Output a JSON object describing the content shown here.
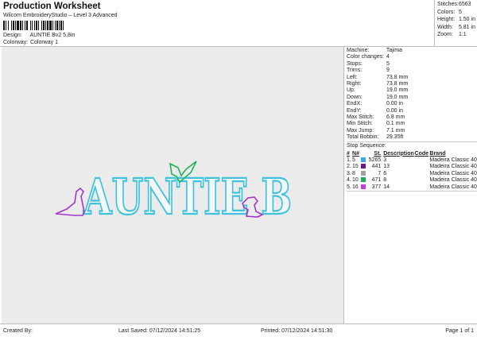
{
  "header": {
    "title": "Production Worksheet",
    "subtitle": "Wilcom EmbroideryStudio – Level 3 Advanced",
    "design_label": "Design:",
    "design_value": "AUNTIE Bv2 5,8in",
    "colorway_label": "Colorway:",
    "colorway_value": "Colorway 1"
  },
  "stats": [
    {
      "k": "Stitches:",
      "v": "6563"
    },
    {
      "k": "Colors:",
      "v": "5"
    },
    {
      "k": "Height:",
      "v": "1.50 in"
    },
    {
      "k": "Width:",
      "v": "5.81 in"
    },
    {
      "k": "Zoom:",
      "v": "1:1"
    }
  ],
  "design": {
    "text": "AUNTIE B",
    "colors": {
      "letters": "#3fc3dc",
      "butterfly": "#22b35a",
      "dino": "#a535c8",
      "background": "#ebebeb"
    }
  },
  "details": [
    {
      "k": "Machine:",
      "v": "Tajima"
    },
    {
      "k": "Color changes:",
      "v": "4"
    },
    {
      "k": "Stops:",
      "v": "5"
    },
    {
      "k": "Trims:",
      "v": "9"
    },
    {
      "k": "Left:",
      "v": "73.8 mm"
    },
    {
      "k": "Right:",
      "v": "73.8 mm"
    },
    {
      "k": "Up:",
      "v": "19.0 mm"
    },
    {
      "k": "Down:",
      "v": "19.0 mm"
    },
    {
      "k": "EndX:",
      "v": "0.00 in"
    },
    {
      "k": "EndY:",
      "v": "0.00 in"
    },
    {
      "k": "Max Stitch:",
      "v": "6.8 mm"
    },
    {
      "k": "Min Stitch:",
      "v": "0.1 mm"
    },
    {
      "k": "Max Jump:",
      "v": "7.1 mm"
    },
    {
      "k": "Total Bobbin:",
      "v": "29.35ft"
    }
  ],
  "stop_sequence": {
    "title": "Stop Sequence:",
    "headers": [
      "#",
      "N#",
      "",
      "St.",
      "Description",
      "Code",
      "Brand"
    ],
    "rows": [
      {
        "idx": "1.",
        "n": "5",
        "color": "#3aa8e8",
        "st": "5265",
        "desc": "3",
        "code": "",
        "brand": "Madeira Classic 40"
      },
      {
        "idx": "2.",
        "n": "15",
        "color": "#6a1a8c",
        "st": "441",
        "desc": "13",
        "code": "",
        "brand": "Madeira Classic 40"
      },
      {
        "idx": "3.",
        "n": "8",
        "color": "#a0a0a0",
        "st": "7",
        "desc": "6",
        "code": "",
        "brand": "Madeira Classic 40"
      },
      {
        "idx": "4.",
        "n": "10",
        "color": "#1faa55",
        "st": "471",
        "desc": "8",
        "code": "",
        "brand": "Madeira Classic 40"
      },
      {
        "idx": "5.",
        "n": "16",
        "color": "#c23fd8",
        "st": "377",
        "desc": "14",
        "code": "",
        "brand": "Madeira Classic 40"
      }
    ]
  },
  "footer": {
    "created": "Created By:",
    "saved": "Last Saved: 07/12/2024 14:51:25",
    "printed": "Printed: 07/12/2024 14:51:30",
    "page": "Page 1 of 1"
  }
}
